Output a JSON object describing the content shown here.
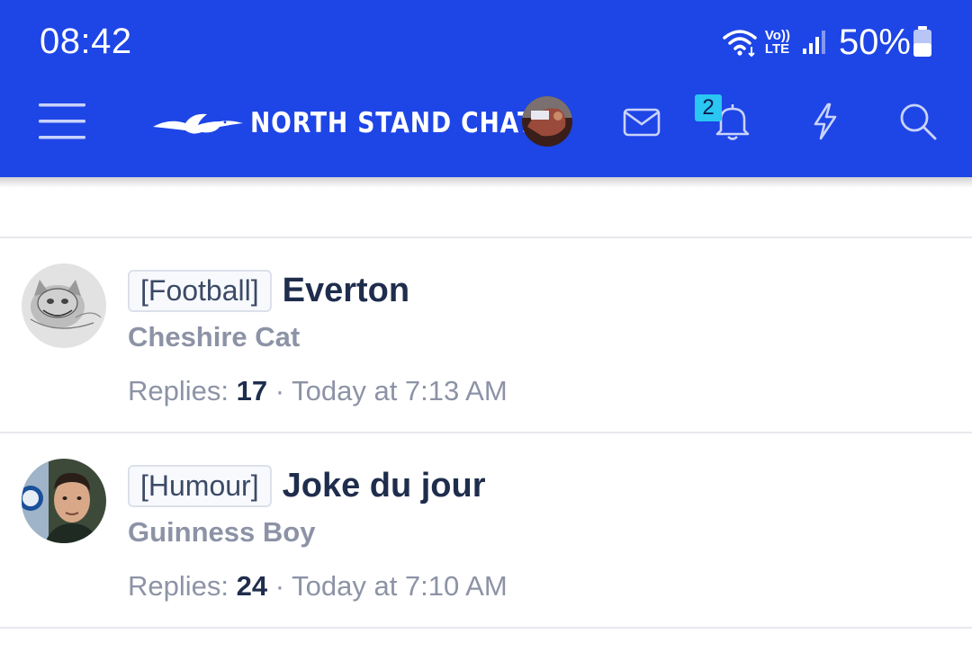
{
  "status": {
    "time": "08:42",
    "network": "Vo))",
    "network_sub": "LTE",
    "battery": "50%"
  },
  "nav": {
    "logo_text": "NORTH STAND CHAT",
    "alerts_badge": "2"
  },
  "threads": [
    {
      "prefix": "[Football]",
      "title": "Everton",
      "author": "Cheshire Cat",
      "replies_label": "Replies:",
      "replies": "17",
      "separator": "·",
      "time": "Today at 7:13 AM"
    },
    {
      "prefix": "[Humour]",
      "title": "Joke du jour",
      "author": "Guinness Boy",
      "replies_label": "Replies:",
      "replies": "24",
      "separator": "·",
      "time": "Today at 7:10 AM"
    }
  ]
}
